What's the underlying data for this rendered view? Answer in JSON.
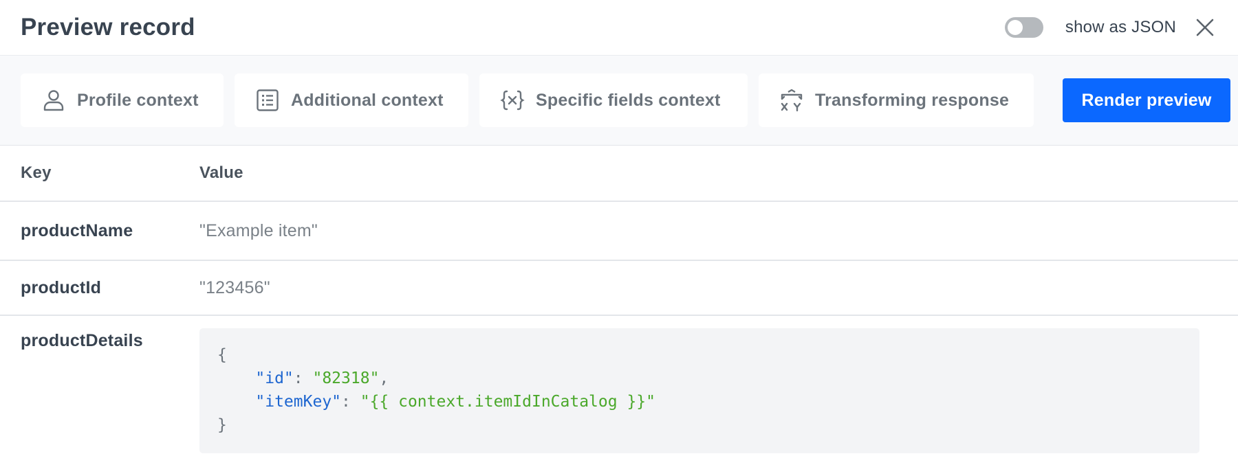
{
  "header": {
    "title": "Preview record",
    "toggle_label": "show as JSON",
    "toggle_on": false
  },
  "toolbar": {
    "buttons": [
      {
        "label": "Profile context",
        "icon": "user-icon"
      },
      {
        "label": "Additional context",
        "icon": "list-icon"
      },
      {
        "label": "Specific fields context",
        "icon": "variable-icon"
      },
      {
        "label": "Transforming response",
        "icon": "transform-icon"
      }
    ],
    "render_label": "Render preview"
  },
  "table": {
    "headers": {
      "key": "Key",
      "value": "Value"
    },
    "rows": [
      {
        "key": "productName",
        "value": "\"Example item\""
      },
      {
        "key": "productId",
        "value": "\"123456\""
      },
      {
        "key": "productDetails"
      }
    ]
  },
  "code": {
    "open": "{",
    "close": "}",
    "indent": "    ",
    "colon": ": ",
    "comma": ",",
    "lines": [
      {
        "key": "\"id\"",
        "value": "\"82318\""
      },
      {
        "key": "\"itemKey\"",
        "value": "\"{{ context.itemIdInCatalog }}\""
      }
    ]
  },
  "colors": {
    "primary": "#0b68ff",
    "code_key": "#1e66d0",
    "code_string": "#4aa82a",
    "toolbar_bg": "#f8f9fb",
    "code_bg": "#f3f4f6"
  }
}
